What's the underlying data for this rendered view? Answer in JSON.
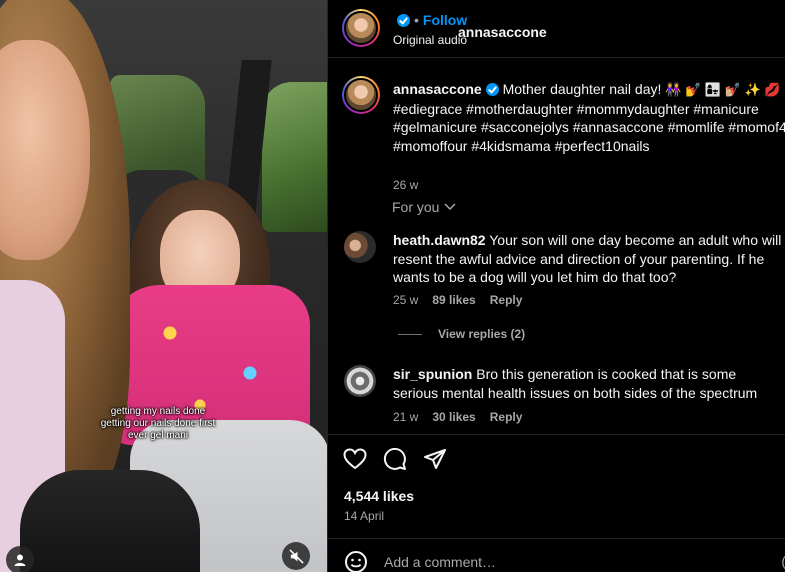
{
  "media": {
    "caption_lines": [
      "getting my nails done",
      "getting our nails done first",
      "ever gel mani"
    ],
    "user_icon": "user-icon",
    "mute_icon": "muted-speaker-icon"
  },
  "header": {
    "username": "annasaccone",
    "separator": "•",
    "follow_label": "Follow",
    "audio": "Original audio"
  },
  "post_caption": {
    "username": "annasaccone",
    "text": "Mother daughter nail day!",
    "emojis": "👭 💅 👩‍👧 💅🏼 ✨ 💋",
    "hashtags": "#ediegrace #motherdaughter #mommydaughter #manicure #gelmanicure #sacconejolys #annasaccone #momlife #momof4 #momoffour #4kidsmama #perfect10nails",
    "time": "26 w"
  },
  "for_you_label": "For you",
  "comments": [
    {
      "username": "heath.dawn82",
      "text": "Your son will one day become an adult who will resent the awful advice and direction of your parenting. If he wants to be a dog will you let him do that too?",
      "time": "25 w",
      "likes": "89 likes",
      "reply": "Reply"
    },
    {
      "username": "sir_spunion",
      "text": "Bro this generation is cooked that is some serious mental health issues on both sides of the spectrum",
      "time": "21 w",
      "likes": "30 likes",
      "reply": "Reply"
    }
  ],
  "view_replies_label": "View replies (2)",
  "actions": {
    "likes_count": "4,544 likes",
    "date": "14 April"
  },
  "add_comment": {
    "placeholder": "Add a comment…",
    "edge_char": "("
  },
  "colors": {
    "accent": "#0095f6",
    "muted": "#a8a8a8",
    "divider": "#262626"
  }
}
